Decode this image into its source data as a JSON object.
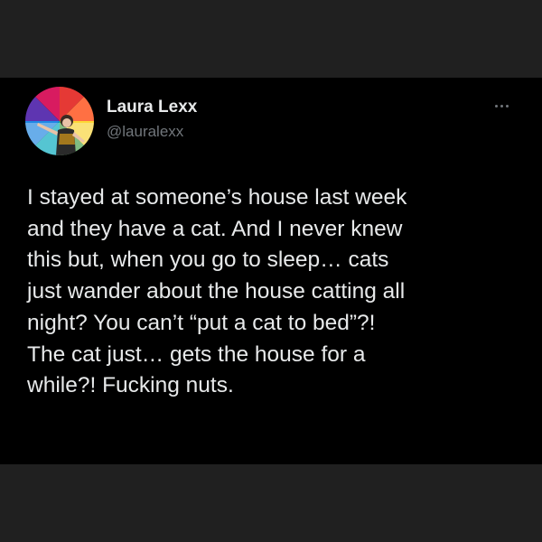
{
  "tweet": {
    "author": {
      "display_name": "Laura Lexx",
      "handle": "@lauralexx",
      "avatar_icon": "profile-avatar"
    },
    "more_icon": "more-options-icon",
    "body_lines": [
      "I stayed at someone’s house last week",
      "and they have a cat. And I never knew",
      "this but, when you go to sleep… cats",
      "just wander about the house catting all",
      "night? You can’t “put a cat to bed”?!",
      "The cat just… gets the house for a",
      "while?! Fucking nuts."
    ]
  },
  "colors": {
    "outer_background": "#202020",
    "card_background": "#000000",
    "primary_text": "#e7e9ea",
    "secondary_text": "#71767b"
  }
}
